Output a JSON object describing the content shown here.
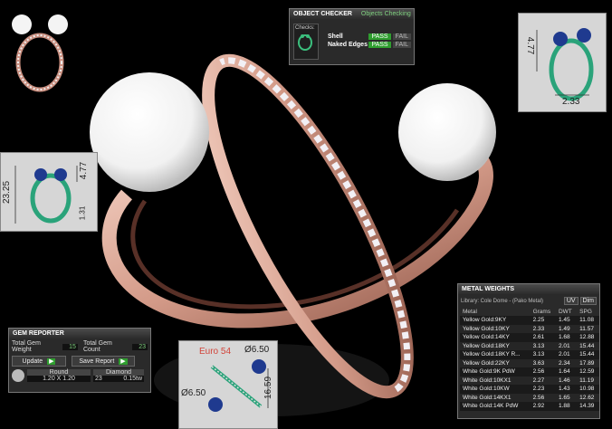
{
  "object_checker": {
    "title": "OBJECT CHECKER",
    "subtitle": "Objects Checking",
    "checks_label": "Checks:",
    "rows": [
      {
        "name": "Shell",
        "pass": "PASS",
        "fail": "FAIL"
      },
      {
        "name": "Naked Edges",
        "pass": "PASS",
        "fail": "FAIL"
      }
    ]
  },
  "gem_reporter": {
    "title": "GEM REPORTER",
    "total_weight_label": "Total Gem Weight",
    "total_weight_value": "15",
    "total_count_label": "Total Gem Count",
    "total_count_value": "23",
    "update_label": "Update",
    "save_report_label": "Save Report",
    "col_round": "Round",
    "col_diamond": "Diamond",
    "round_size": "1.20 X 1.20",
    "count": "23",
    "weight": "0.15tw"
  },
  "metal_weights": {
    "title": "METAL WEIGHTS",
    "library_label": "Library: Cole Dome - (Pako Metal)",
    "btn_uv": "UV",
    "btn_dim": "Dim",
    "headers": [
      "Metal",
      "Grams",
      "DWT",
      "SPG"
    ],
    "rows": [
      [
        "Yellow Gold:9KY",
        "2.25",
        "1.45",
        "11.08"
      ],
      [
        "Yellow Gold:10KY",
        "2.33",
        "1.49",
        "11.57"
      ],
      [
        "Yellow Gold:14KY",
        "2.61",
        "1.68",
        "12.88"
      ],
      [
        "Yellow Gold:18KY",
        "3.13",
        "2.01",
        "15.44"
      ],
      [
        "Yellow Gold:18KY R...",
        "3.13",
        "2.01",
        "15.44"
      ],
      [
        "Yellow Gold:22KY",
        "3.63",
        "2.34",
        "17.89"
      ],
      [
        "White Gold:9K PdW",
        "2.56",
        "1.64",
        "12.59"
      ],
      [
        "White Gold:10KX1",
        "2.27",
        "1.46",
        "11.19"
      ],
      [
        "White Gold:10KW",
        "2.23",
        "1.43",
        "10.98"
      ],
      [
        "White Gold:14KX1",
        "2.56",
        "1.65",
        "12.62"
      ],
      [
        "White Gold:14K PdW",
        "2.92",
        "1.88",
        "14.39"
      ]
    ]
  },
  "dims": {
    "top_right_a": "4.77",
    "top_right_b": "2.33",
    "left_a": "23.25",
    "left_b": "4.77",
    "left_c": "1.31",
    "bottom_size": "Euro 54",
    "bottom_a": "Ø6.50",
    "bottom_b": "Ø6.50",
    "bottom_c": "16.59"
  }
}
